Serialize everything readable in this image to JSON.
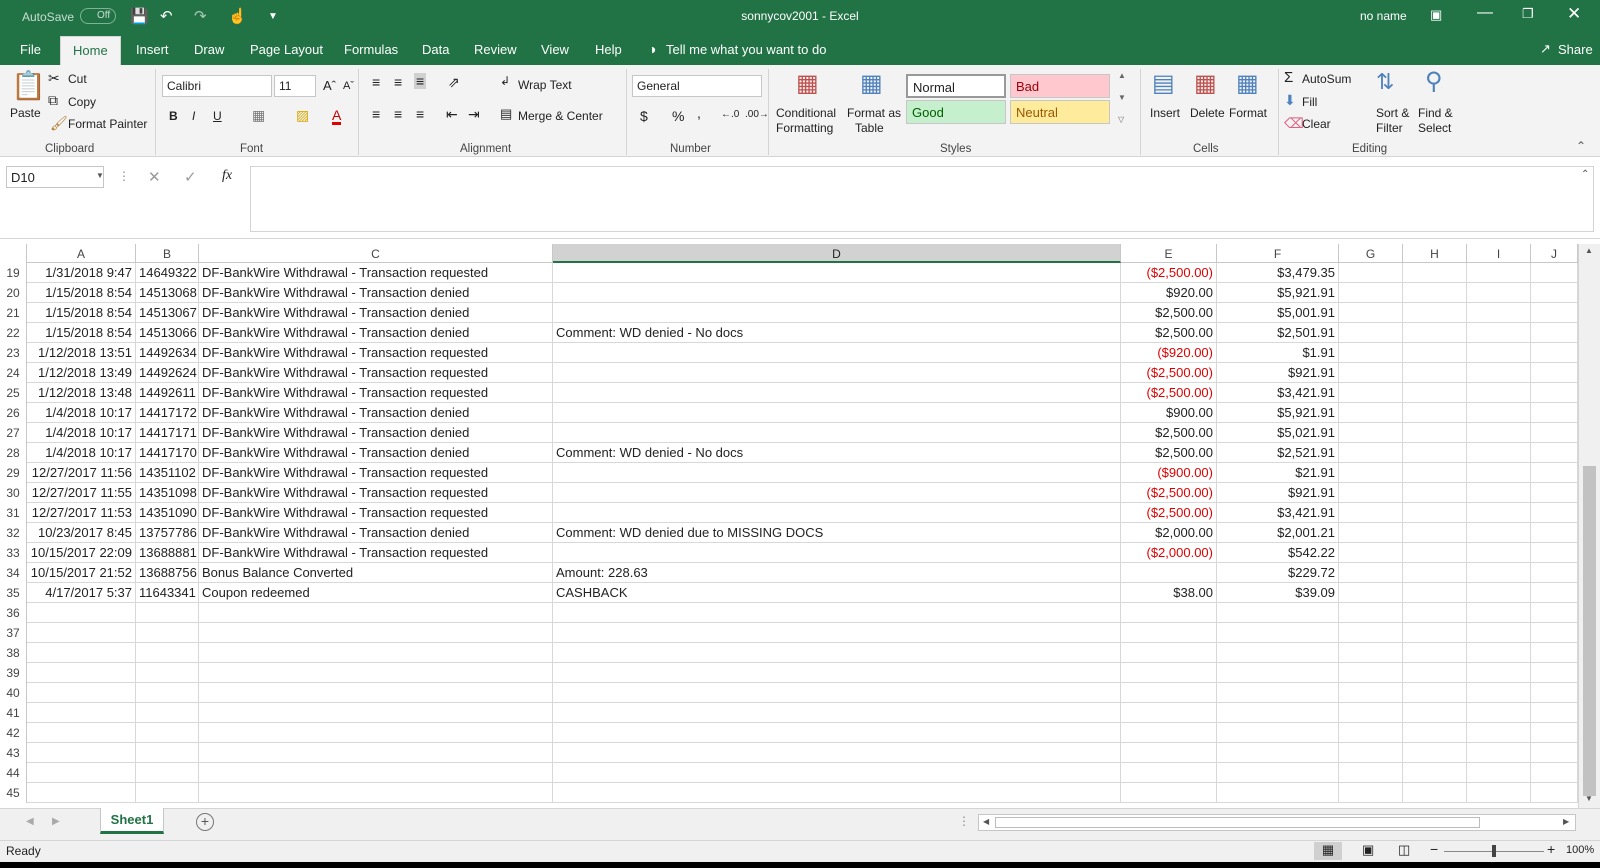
{
  "app": {
    "title": "sonnycov2001  -  Excel",
    "autosave_label": "AutoSave",
    "autosave_state": "Off",
    "user": "no name",
    "share": "Share"
  },
  "menu_tabs": [
    "File",
    "Home",
    "Insert",
    "Draw",
    "Page Layout",
    "Formulas",
    "Data",
    "Review",
    "View",
    "Help"
  ],
  "tell_me": "Tell me what you want to do",
  "ribbon": {
    "clipboard": {
      "paste": "Paste",
      "cut": "Cut",
      "copy": "Copy",
      "format_painter": "Format Painter",
      "label": "Clipboard"
    },
    "font": {
      "family": "Calibri",
      "size": "11",
      "label": "Font",
      "bold": "B",
      "italic": "I",
      "underline": "U"
    },
    "alignment": {
      "wrap": "Wrap Text",
      "merge": "Merge & Center",
      "label": "Alignment"
    },
    "number": {
      "format": "General",
      "label": "Number",
      "currency": "$",
      "percent": "%",
      "comma": ","
    },
    "styles": {
      "conditional": "Conditional",
      "conditional2": "Formatting",
      "format_as": "Format as",
      "format_as2": "Table",
      "normal": "Normal",
      "bad": "Bad",
      "good": "Good",
      "neutral": "Neutral",
      "label": "Styles"
    },
    "cells": {
      "insert": "Insert",
      "delete": "Delete",
      "format": "Format",
      "label": "Cells"
    },
    "editing": {
      "autosum": "AutoSum",
      "fill": "Fill",
      "clear": "Clear",
      "sort": "Sort &",
      "sort2": "Filter",
      "find": "Find &",
      "find2": "Select",
      "label": "Editing"
    }
  },
  "formula_bar": {
    "name_box": "D10",
    "fx": "fx",
    "value": ""
  },
  "columns": [
    "A",
    "B",
    "C",
    "D",
    "E",
    "F",
    "G",
    "H",
    "I",
    "J"
  ],
  "rows": [
    {
      "n": "19",
      "a": "1/31/2018 9:47",
      "b": "14649322",
      "c": "DF-BankWire Withdrawal - Transaction requested",
      "d": "",
      "e": "($2,500.00)",
      "e_neg": true,
      "f": "$3,479.35"
    },
    {
      "n": "20",
      "a": "1/15/2018 8:54",
      "b": "14513068",
      "c": "DF-BankWire Withdrawal - Transaction denied",
      "d": "",
      "e": "$920.00",
      "e_neg": false,
      "f": "$5,921.91"
    },
    {
      "n": "21",
      "a": "1/15/2018 8:54",
      "b": "14513067",
      "c": "DF-BankWire Withdrawal - Transaction denied",
      "d": "",
      "e": "$2,500.00",
      "e_neg": false,
      "f": "$5,001.91"
    },
    {
      "n": "22",
      "a": "1/15/2018 8:54",
      "b": "14513066",
      "c": "DF-BankWire Withdrawal - Transaction denied",
      "d": "Comment: WD denied - No docs",
      "e": "$2,500.00",
      "e_neg": false,
      "f": "$2,501.91"
    },
    {
      "n": "23",
      "a": "1/12/2018 13:51",
      "b": "14492634",
      "c": "DF-BankWire Withdrawal - Transaction requested",
      "d": "",
      "e": "($920.00)",
      "e_neg": true,
      "f": "$1.91"
    },
    {
      "n": "24",
      "a": "1/12/2018 13:49",
      "b": "14492624",
      "c": "DF-BankWire Withdrawal - Transaction requested",
      "d": "",
      "e": "($2,500.00)",
      "e_neg": true,
      "f": "$921.91"
    },
    {
      "n": "25",
      "a": "1/12/2018 13:48",
      "b": "14492611",
      "c": "DF-BankWire Withdrawal - Transaction requested",
      "d": "",
      "e": "($2,500.00)",
      "e_neg": true,
      "f": "$3,421.91"
    },
    {
      "n": "26",
      "a": "1/4/2018 10:17",
      "b": "14417172",
      "c": "DF-BankWire Withdrawal - Transaction denied",
      "d": "",
      "e": "$900.00",
      "e_neg": false,
      "f": "$5,921.91"
    },
    {
      "n": "27",
      "a": "1/4/2018 10:17",
      "b": "14417171",
      "c": "DF-BankWire Withdrawal - Transaction denied",
      "d": "",
      "e": "$2,500.00",
      "e_neg": false,
      "f": "$5,021.91"
    },
    {
      "n": "28",
      "a": "1/4/2018 10:17",
      "b": "14417170",
      "c": "DF-BankWire Withdrawal - Transaction denied",
      "d": "Comment: WD denied - No docs",
      "e": "$2,500.00",
      "e_neg": false,
      "f": "$2,521.91"
    },
    {
      "n": "29",
      "a": "12/27/2017 11:56",
      "b": "14351102",
      "c": "DF-BankWire Withdrawal - Transaction requested",
      "d": "",
      "e": "($900.00)",
      "e_neg": true,
      "f": "$21.91"
    },
    {
      "n": "30",
      "a": "12/27/2017 11:55",
      "b": "14351098",
      "c": "DF-BankWire Withdrawal - Transaction requested",
      "d": "",
      "e": "($2,500.00)",
      "e_neg": true,
      "f": "$921.91"
    },
    {
      "n": "31",
      "a": "12/27/2017 11:53",
      "b": "14351090",
      "c": "DF-BankWire Withdrawal - Transaction requested",
      "d": "",
      "e": "($2,500.00)",
      "e_neg": true,
      "f": "$3,421.91"
    },
    {
      "n": "32",
      "a": "10/23/2017 8:45",
      "b": "13757786",
      "c": "DF-BankWire Withdrawal - Transaction denied",
      "d": "Comment: WD denied due to MISSING DOCS",
      "e": "$2,000.00",
      "e_neg": false,
      "f": "$2,001.21"
    },
    {
      "n": "33",
      "a": "10/15/2017 22:09",
      "b": "13688881",
      "c": "DF-BankWire Withdrawal - Transaction requested",
      "d": "",
      "e": "($2,000.00)",
      "e_neg": true,
      "f": "$542.22"
    },
    {
      "n": "34",
      "a": "10/15/2017 21:52",
      "b": "13688756",
      "c": "Bonus Balance Converted",
      "d": "Amount: 228.63",
      "e": "",
      "e_neg": false,
      "f": "$229.72"
    },
    {
      "n": "35",
      "a": "4/17/2017 5:37",
      "b": "11643341",
      "c": "Coupon redeemed",
      "d": "CASHBACK",
      "e": "$38.00",
      "e_neg": false,
      "f": "$39.09"
    },
    {
      "n": "36",
      "a": "",
      "b": "",
      "c": "",
      "d": "",
      "e": "",
      "e_neg": false,
      "f": ""
    },
    {
      "n": "37",
      "a": "",
      "b": "",
      "c": "",
      "d": "",
      "e": "",
      "e_neg": false,
      "f": ""
    },
    {
      "n": "38",
      "a": "",
      "b": "",
      "c": "",
      "d": "",
      "e": "",
      "e_neg": false,
      "f": ""
    },
    {
      "n": "39",
      "a": "",
      "b": "",
      "c": "",
      "d": "",
      "e": "",
      "e_neg": false,
      "f": ""
    },
    {
      "n": "40",
      "a": "",
      "b": "",
      "c": "",
      "d": "",
      "e": "",
      "e_neg": false,
      "f": ""
    },
    {
      "n": "41",
      "a": "",
      "b": "",
      "c": "",
      "d": "",
      "e": "",
      "e_neg": false,
      "f": ""
    },
    {
      "n": "42",
      "a": "",
      "b": "",
      "c": "",
      "d": "",
      "e": "",
      "e_neg": false,
      "f": ""
    },
    {
      "n": "43",
      "a": "",
      "b": "",
      "c": "",
      "d": "",
      "e": "",
      "e_neg": false,
      "f": ""
    },
    {
      "n": "44",
      "a": "",
      "b": "",
      "c": "",
      "d": "",
      "e": "",
      "e_neg": false,
      "f": ""
    },
    {
      "n": "45",
      "a": "",
      "b": "",
      "c": "",
      "d": "",
      "e": "",
      "e_neg": false,
      "f": ""
    }
  ],
  "sheet_tab": "Sheet1",
  "status": {
    "ready": "Ready",
    "zoom": "100%"
  },
  "colors": {
    "excel_green": "#217346",
    "negative": "#e00000",
    "bad_bg": "#ffc7ce",
    "good_bg": "#c6efce",
    "neutral_bg": "#ffeb9c"
  }
}
